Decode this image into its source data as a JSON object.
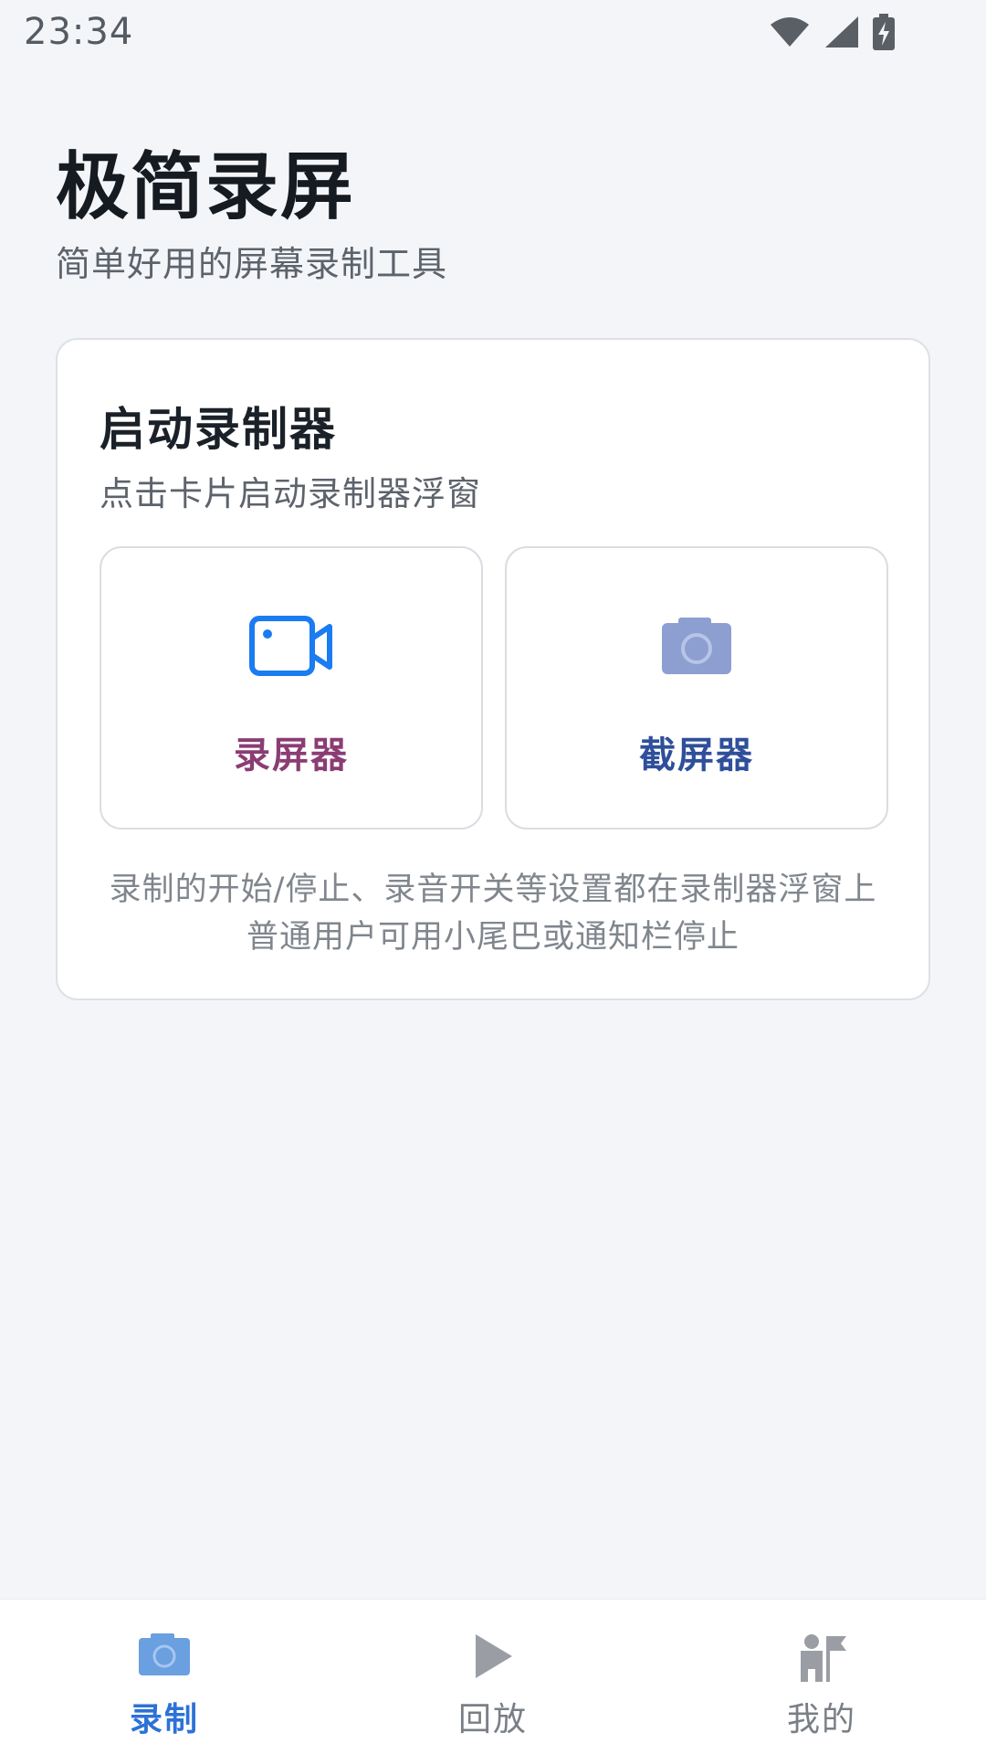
{
  "status_bar": {
    "time": "23:34",
    "icons": [
      "wifi-icon",
      "signal-icon",
      "battery-charging-icon"
    ]
  },
  "header": {
    "title": "极简录屏",
    "subtitle": "简单好用的屏幕录制工具"
  },
  "recorder_card": {
    "title": "启动录制器",
    "subtitle": "点击卡片启动录制器浮窗",
    "tiles": [
      {
        "label": "录屏器",
        "icon": "video-camera-icon",
        "color": "#8a3d74",
        "icon_color": "#1a7cf0"
      },
      {
        "label": "截屏器",
        "icon": "camera-icon",
        "color": "#2f4f9a",
        "icon_color": "#8d9fd1"
      }
    ],
    "note_line1": "录制的开始/停止、录音开关等设置都在录制器浮窗上",
    "note_line2": "普通用户可用小尾巴或通知栏停止"
  },
  "bottom_nav": {
    "items": [
      {
        "label": "录制",
        "icon": "camera-icon",
        "active": true
      },
      {
        "label": "回放",
        "icon": "play-icon",
        "active": false
      },
      {
        "label": "我的",
        "icon": "user-flag-icon",
        "active": false
      }
    ],
    "active_color": "#2c72d6"
  }
}
